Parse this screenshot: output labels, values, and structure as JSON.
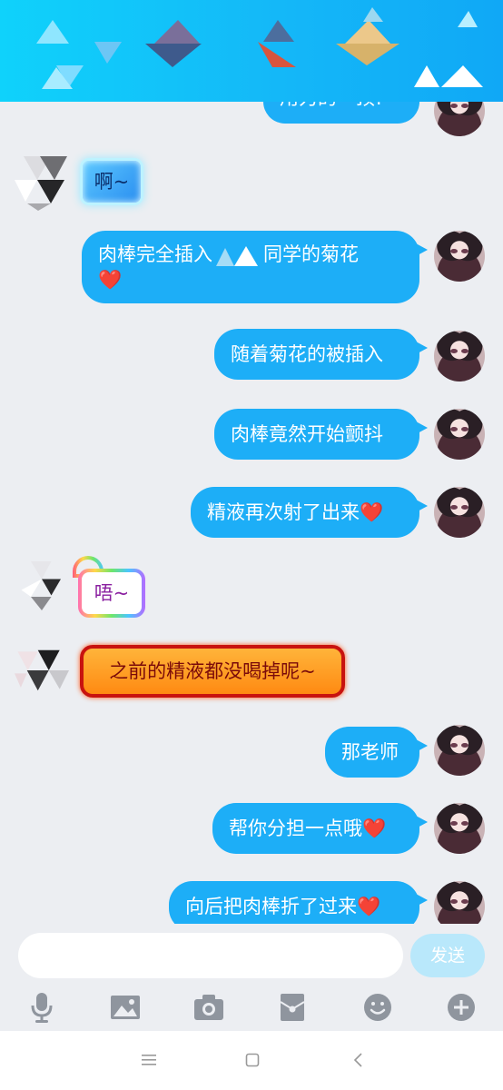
{
  "chat": {
    "top_partial_text": "用力的一顶!",
    "messages": [
      {
        "text": "啊~"
      },
      {
        "text": "肉棒完全插入",
        "text2": "同学的菊花",
        "emoji": "❤️"
      },
      {
        "text": "随着菊花的被插入"
      },
      {
        "text": "肉棒竟然开始颤抖"
      },
      {
        "text": "精液再次射了出来",
        "emoji": "❤️"
      },
      {
        "text": "唔~"
      },
      {
        "text": "之前的精液都没喝掉呢~"
      },
      {
        "text": "那老师"
      },
      {
        "text": "帮你分担一点哦",
        "emoji": "❤️"
      },
      {
        "text": "向后把肉棒折了过来",
        "emoji": "❤️"
      }
    ]
  },
  "input": {
    "value": "",
    "send_label": "发送"
  },
  "toolbar": [
    "microphone-icon",
    "image-icon",
    "camera-icon",
    "red-packet-icon",
    "emoji-icon",
    "plus-icon"
  ],
  "navbar": [
    "menu-icon",
    "home-icon",
    "back-icon"
  ],
  "colors": {
    "header": "#14b8f8",
    "bubble": "#1daef7",
    "background": "#eceef2"
  }
}
